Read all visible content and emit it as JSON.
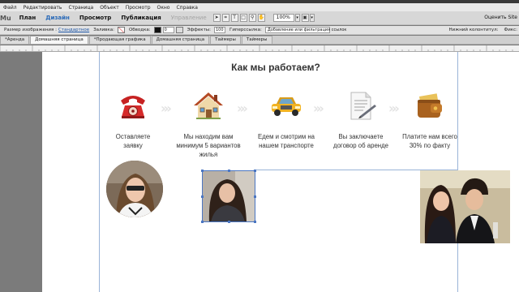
{
  "menu": [
    "Файл",
    "Редактировать",
    "Страница",
    "Объект",
    "Просмотр",
    "Окно",
    "Справка"
  ],
  "modes": {
    "logo": "Mu",
    "plan": "План",
    "design": "Дизайн",
    "preview": "Просмотр",
    "publish": "Публикация",
    "manage": "Управление"
  },
  "toolbar": {
    "zoom": "100%",
    "right_label": "Оценить Site"
  },
  "props": {
    "image_label": "Размер изображения :",
    "image_value": "Стандартное",
    "fill_label": "Заливка:",
    "stroke_label": "Обводка:",
    "stroke_width": "0",
    "effects_label": "Эффекты:",
    "effects_value": "100",
    "hyperlinks_label": "Гиперссылка:",
    "hyperlink_value": "Добавление или фильтрация ссылок",
    "colontitle_label": "Нижний колонтитул:",
    "fix_label": "Фикс:"
  },
  "tabs": [
    "*Аренда",
    "Домашняя страница",
    "*Продающая графика",
    "Домашняя страница",
    "Таймеры",
    "Таймеры"
  ],
  "colors": {
    "accent": "#2a6ab8",
    "guide": "#9ab4d8",
    "selection": "#4b76c2",
    "canvas": "#7b7b7b"
  },
  "content": {
    "heading": "Как мы работаем?",
    "steps": [
      {
        "icon": "red-telephone-icon",
        "lines": [
          "Оставляете",
          "заявку"
        ]
      },
      {
        "icon": "house-icon",
        "lines": [
          "Мы находим вам",
          "минимум 5 вариантов",
          "жилья"
        ]
      },
      {
        "icon": "taxi-car-icon",
        "lines": [
          "Едем и смотрим на",
          "нашем транспорте"
        ]
      },
      {
        "icon": "contract-document-icon",
        "lines": [
          "Вы заключаете",
          "договор об аренде"
        ]
      },
      {
        "icon": "wallet-icon",
        "lines": [
          "Платите нам всего",
          "30% по факту"
        ]
      }
    ]
  }
}
